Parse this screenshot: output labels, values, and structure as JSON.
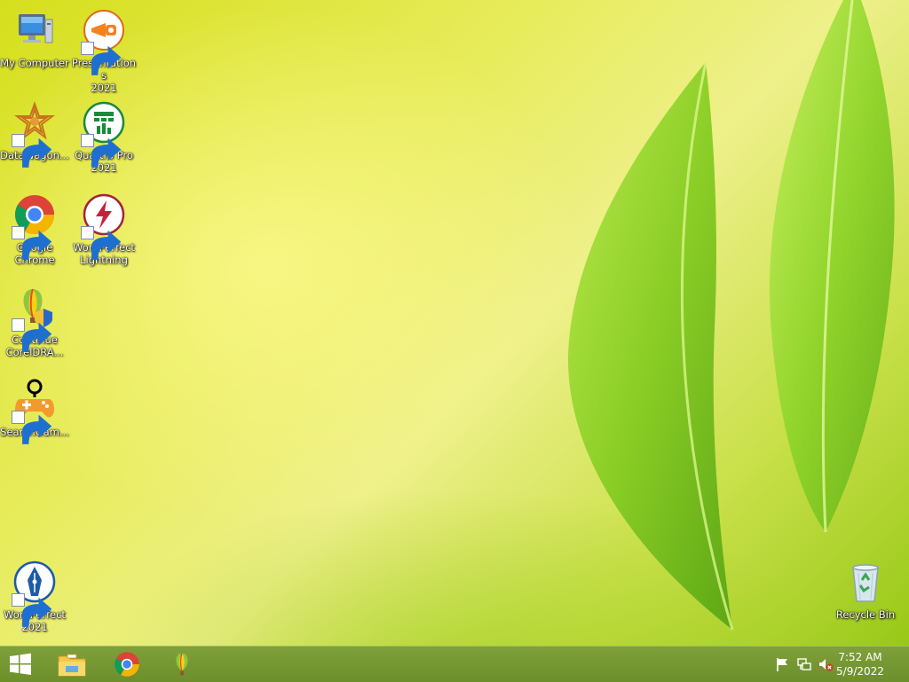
{
  "desktop": {
    "icons": [
      {
        "id": "my-computer",
        "label": "My Computer",
        "icon": "computer-icon"
      },
      {
        "id": "presentations",
        "label": "Presentations\n2021",
        "icon": "presentations-icon"
      },
      {
        "id": "datawagon",
        "label": "DataWagon...",
        "icon": "datawagon-icon"
      },
      {
        "id": "quattro-pro",
        "label": "Quattro Pro\n2021",
        "icon": "quattro-pro-icon"
      },
      {
        "id": "google-chrome",
        "label": "Google\nChrome",
        "icon": "chrome-icon"
      },
      {
        "id": "wordperfect-lightning",
        "label": "WordPerfect\nLightning",
        "icon": "lightning-icon"
      },
      {
        "id": "continue-coreldraw",
        "label": "Continue\nCorelDRA...",
        "icon": "coreldraw-icon"
      },
      {
        "id": "searchgames",
        "label": "SearchGam...",
        "icon": "gamepad-icon"
      },
      {
        "id": "wordperfect-2021",
        "label": "WordPerfect\n2021",
        "icon": "wordperfect-icon"
      },
      {
        "id": "recycle-bin",
        "label": "Recycle Bin",
        "icon": "recycle-bin-icon"
      }
    ]
  },
  "taskbar": {
    "buttons": [
      {
        "id": "start",
        "icon": "windows-logo-icon"
      },
      {
        "id": "file-explorer",
        "icon": "file-explorer-icon"
      },
      {
        "id": "chrome",
        "icon": "chrome-icon"
      },
      {
        "id": "coreldraw",
        "icon": "coreldraw-icon"
      }
    ],
    "tray": [
      {
        "id": "action-center",
        "icon": "flag-icon"
      },
      {
        "id": "network",
        "icon": "network-icon"
      },
      {
        "id": "volume",
        "icon": "volume-muted-icon"
      }
    ],
    "clock": {
      "time": "7:52 AM",
      "date": "5/9/2022"
    }
  },
  "colors": {
    "taskbar": "#7497339e",
    "wallpaper_light": "#eef08a",
    "wallpaper_dark": "#98c818",
    "leaf": "#8fd42a"
  }
}
